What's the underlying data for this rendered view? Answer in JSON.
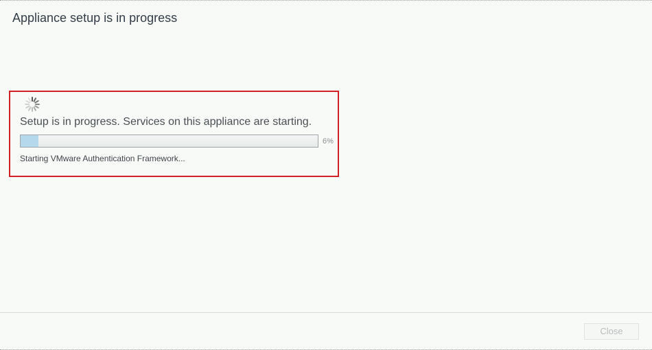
{
  "dialog": {
    "title": "Appliance setup is in progress"
  },
  "progress_panel": {
    "spinner_icon": "spinner-icon",
    "message": "Setup is in progress. Services on this appliance are starting.",
    "progress_value": 0.06,
    "progress_label": "6%",
    "status_text": "Starting VMware Authentication Framework..."
  },
  "footer": {
    "close_label": "Close"
  },
  "colors": {
    "highlight_border": "#d21f26",
    "progress_fill": "#b6d8ec",
    "background": "#f7faf6"
  }
}
